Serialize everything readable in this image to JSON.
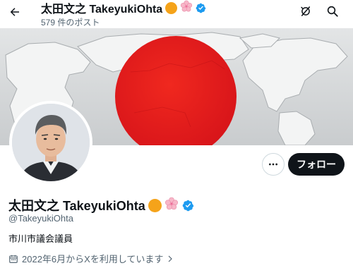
{
  "header": {
    "name": "太田文之 TakeyukiOhta",
    "post_count": "579 件のポスト"
  },
  "profile": {
    "name": "太田文之 TakeyukiOhta",
    "handle": "@TakeyukiOhta",
    "bio": "市川市議会議員",
    "joined": "2022年6月からXを利用しています",
    "follow_label": "フォロー"
  },
  "icons": {
    "back": "arrow-left-icon",
    "grok": "grok-icon",
    "search": "search-icon",
    "more": "more-horizontal-icon",
    "verified": "verified-badge-icon",
    "calendar": "calendar-icon",
    "name_emoji": [
      "orange-circle-emoji",
      "cherry-blossom-emoji"
    ]
  },
  "colors": {
    "verified": "#1d9bf0",
    "follow_bg": "#0f1419",
    "secondary_text": "#536471",
    "sun_red": "#e5201c",
    "orange_circle": "#f5a31a",
    "cherry_blossom": "#f7b6c8"
  }
}
